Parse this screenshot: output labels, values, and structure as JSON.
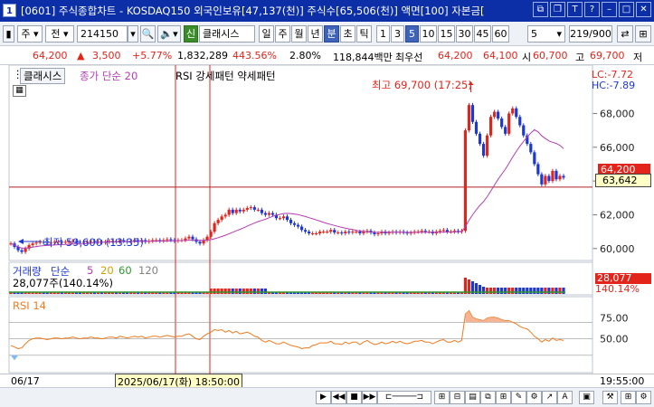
{
  "window": {
    "number": "1",
    "title": "[0601] 주식종합차트 - KOSDAQ150 외국인보유[47,137(천)] 주식수[65,506(천)] 액면[100] 자본금["
  },
  "toolbar": {
    "symbol_code": "214150",
    "mode_stock": "주",
    "mode_prev": "전",
    "stock_name": "클래시스",
    "stock_badge": "신",
    "periods": [
      "일",
      "주",
      "월",
      "년",
      "분",
      "초",
      "틱"
    ],
    "active_period": "분",
    "intervals": [
      "1",
      "3",
      "5",
      "10",
      "15",
      "30",
      "45",
      "60"
    ],
    "active_interval": "5",
    "interval_value": "5",
    "count_value": "219/900"
  },
  "pricebar": {
    "price": "64,200",
    "change_arrow": "▲",
    "change": "3,500",
    "change_pct": "+5.77%",
    "volume": "1,832,289",
    "volume_pct": "443.56%",
    "ratio": "2.80%",
    "amount": "118,844백만",
    "best_label": "최우선",
    "ask": "64,200",
    "bid": "64,100",
    "open_label": "시",
    "open": "60,700",
    "high_label": "고",
    "high": "69,700",
    "low_label": "저"
  },
  "chart": {
    "header_name": "클래시스",
    "header_ma": "종가 단순 20",
    "header_rsi": "RSI 강세패턴  약세패턴",
    "lc": "LC:-7.72",
    "hc": "HC:-7.89",
    "y_ticks": [
      "68,000",
      "66,000",
      "64,000",
      "62,000",
      "60,000"
    ],
    "current_price_tag": "64,200",
    "crosshair_value": "63,642",
    "high_note": "최고 69,700 (17:25)",
    "low_note": "최저 59,600 (13:35)",
    "volume_title": "거래량",
    "volume_ma_label": "단순",
    "volume_ma": [
      "5",
      "20",
      "60",
      "120"
    ],
    "volume_sub": "28,077주(140.14%)",
    "volume_tag": "28,077",
    "volume_tag_pct": "140.14%",
    "rsi_title": "RSI 14",
    "rsi_ticks": [
      "75.00",
      "50.00"
    ],
    "x_start": "06/17",
    "x_end": "19:55:00",
    "crosshair_time": "2025/06/17(화) 18:50:00",
    "colors": {
      "up": "#e3241b",
      "down": "#1c37d8",
      "ma": "#b43cb4",
      "rsi": "#f07a1e"
    }
  },
  "chart_data": {
    "type": "candlestick",
    "y_range": [
      59400,
      69900
    ],
    "closes": [
      60300,
      60100,
      59900,
      59800,
      60000,
      60200,
      60300,
      60350,
      60400,
      60350,
      60300,
      60350,
      60400,
      60400,
      60350,
      60400,
      60400,
      60450,
      60400,
      60350,
      60400,
      60400,
      60450,
      60400,
      60400,
      60350,
      60400,
      60450,
      60450,
      60400,
      60500,
      60450,
      60400,
      60450,
      60500,
      60450,
      60500,
      60400,
      60450,
      60500,
      60500,
      60450,
      60500,
      60550,
      60500,
      60450,
      60500,
      60500,
      60600,
      60700,
      60550,
      60400,
      60300,
      60500,
      60700,
      61000,
      61500,
      61700,
      61900,
      62000,
      62300,
      62100,
      62300,
      62200,
      62300,
      62400,
      62450,
      62300,
      62300,
      62100,
      62000,
      62100,
      62000,
      61800,
      61800,
      61900,
      61700,
      61500,
      61400,
      61300,
      61100,
      61000,
      60900,
      60900,
      60900,
      61000,
      61000,
      61000,
      61100,
      60950,
      60950,
      60900,
      61000,
      60950,
      61000,
      61000,
      60900,
      61000,
      61050,
      60950,
      60850,
      60900,
      61000,
      60900,
      60950,
      61000,
      60950,
      61000,
      60950,
      60900,
      60950,
      61000,
      61000,
      61050,
      61000,
      61000,
      60900,
      61000,
      61050,
      61100,
      61000,
      61000,
      61050,
      61000,
      61050,
      67000,
      68500,
      67500,
      66800,
      66200,
      65500,
      66700,
      67800,
      68100,
      67700,
      67200,
      66800,
      68000,
      68300,
      67800,
      67300,
      66700,
      66200,
      65700,
      65000,
      64400,
      63800,
      64300,
      64000,
      64600,
      64100,
      64300,
      64200
    ],
    "rsi": [
      42,
      40,
      38,
      39,
      44,
      48,
      50,
      51,
      51,
      50,
      49,
      50,
      51,
      51,
      50,
      51,
      51,
      52,
      51,
      50,
      51,
      51,
      52,
      51,
      51,
      50,
      51,
      52,
      52,
      51,
      53,
      52,
      51,
      52,
      53,
      52,
      53,
      51,
      52,
      53,
      53,
      52,
      53,
      54,
      53,
      52,
      53,
      53,
      55,
      56,
      53,
      50,
      49,
      53,
      56,
      58,
      61,
      60,
      61,
      58,
      60,
      57,
      59,
      56,
      57,
      58,
      56,
      53,
      52,
      48,
      46,
      48,
      46,
      44,
      44,
      46,
      44,
      42,
      41,
      40,
      38,
      39,
      39,
      42,
      43,
      45,
      45,
      45,
      47,
      44,
      44,
      43,
      46,
      44,
      46,
      46,
      43,
      46,
      48,
      45,
      43,
      44,
      46,
      44,
      45,
      47,
      45,
      47,
      45,
      44,
      45,
      47,
      47,
      48,
      46,
      46,
      44,
      46,
      48,
      49,
      46,
      46,
      48,
      46,
      48,
      80,
      84,
      76,
      74,
      73,
      72,
      75,
      76,
      76,
      75,
      73,
      72,
      72,
      70,
      68,
      65,
      63,
      62,
      58,
      53,
      50,
      46,
      49,
      47,
      51,
      48,
      49,
      48
    ]
  }
}
